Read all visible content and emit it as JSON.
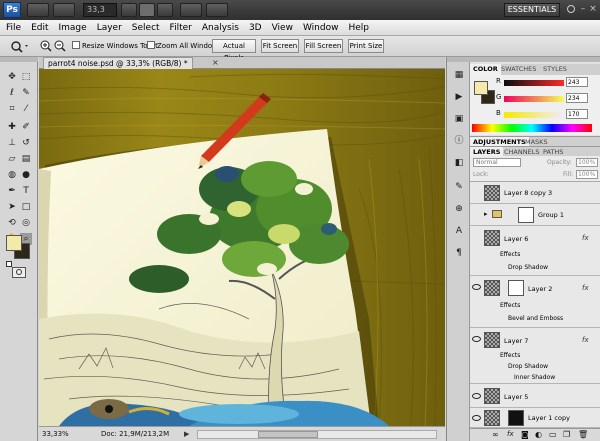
{
  "appbar": {
    "logo": "Ps",
    "zoom_value": "33,3",
    "workspace_label": "ESSENTIALS",
    "window_controls": [
      "–",
      "□",
      "×"
    ]
  },
  "menu": [
    "File",
    "Edit",
    "Image",
    "Layer",
    "Select",
    "Filter",
    "Analysis",
    "3D",
    "View",
    "Window",
    "Help"
  ],
  "options": {
    "resize_windows": "Resize Windows To Fit",
    "zoom_all_windows": "Zoom All Windows",
    "actual_pixels": "Actual Pixels",
    "fit_screen": "Fit Screen",
    "fill_screen": "Fill Screen",
    "print_size": "Print Size"
  },
  "document": {
    "tab_title": "parrot4 noise.psd @ 33,3% (RGB/8) *",
    "zoom_status": "33,33%",
    "doc_status": "Doc: 21,9M/213,2M"
  },
  "color_panel": {
    "tabs": [
      "COLOR",
      "SWATCHES",
      "STYLES"
    ],
    "r_label": "R",
    "r_value": "243",
    "g_label": "G",
    "g_value": "234",
    "b_label": "B",
    "b_value": "170",
    "foreground": "#f3eaaa",
    "background": "#2e2616"
  },
  "adjust_panel": {
    "tabs": [
      "ADJUSTMENTS",
      "MASKS"
    ]
  },
  "layers_panel": {
    "tabs": [
      "LAYERS",
      "CHANNELS",
      "PATHS"
    ],
    "blend_mode": "Normal",
    "opacity_label": "Opacity:",
    "opacity_value": "100%",
    "lock_label": "Lock:",
    "fill_label": "Fill:",
    "fill_value": "100%",
    "layers": [
      {
        "name": "Layer 8 copy 3"
      },
      {
        "name": "Group 1"
      },
      {
        "name": "Layer 6",
        "fx": "fx",
        "effects_label": "Effects",
        "effects": [
          "Drop Shadow"
        ]
      },
      {
        "name": "Layer 2",
        "fx": "fx",
        "effects_label": "Effects",
        "effects": [
          "Bevel and Emboss"
        ]
      },
      {
        "name": "Layer 7",
        "fx": "fx",
        "effects_label": "Effects",
        "effects": [
          "Drop Shadow",
          "Inner Shadow"
        ]
      },
      {
        "name": "Layer 5"
      },
      {
        "name": "Layer 1 copy"
      }
    ]
  }
}
